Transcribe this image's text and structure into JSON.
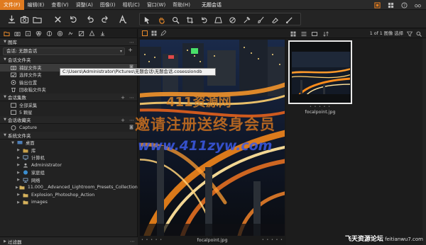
{
  "app": {
    "title": "无题会话"
  },
  "menu": [
    "文件(F)",
    "编辑(E)",
    "查看(V)",
    "调整(A)",
    "图像(I)",
    "相机(C)",
    "窗口(W)",
    "帮助(H)"
  ],
  "window_controls": [
    "restore-icon",
    "grid-icon",
    "help-icon",
    "glasses-icon"
  ],
  "toolbar": {
    "left_icons": [
      "import-icon",
      "camera-icon",
      "open-folder-icon",
      "delete-icon",
      "reset-icon",
      "undo-icon",
      "redo-icon",
      "text-icon"
    ],
    "tools": [
      "cursor-tool-icon",
      "hand-tool-icon",
      "zoom-tool-icon",
      "crop-tool-icon",
      "rotate-tool-icon",
      "keystone-tool-icon",
      "spot-tool-icon",
      "picker-tool-icon",
      "brush-tool-icon",
      "eraser-tool-icon",
      "gradient-tool-icon"
    ]
  },
  "left_panel": {
    "tabs": [
      "folder-icon",
      "camera-icon",
      "info-icon",
      "color-icon",
      "adjust-icon",
      "lens-icon",
      "details-icon",
      "exposure-icon",
      "sharpen-icon",
      "output-icon"
    ],
    "library_header": "图库",
    "session_label": "会话: 无题会话",
    "session_folders_header": "会话文件夹",
    "session_folders": [
      "捕捉文件夹",
      "选择文件夹",
      "输出位置",
      "回收箱文件夹"
    ],
    "session_albums_header": "会话集数",
    "session_albums": [
      "全部采集",
      "5 颗星"
    ],
    "favorites_header": "会话收藏夹",
    "favorites": [
      "Capture"
    ],
    "system_folders_header": "系统文件夹",
    "system_folders": [
      "桌面",
      "库",
      "计算机",
      "Administrator",
      "家庭组",
      "网络",
      "11.000__Advanced_Lightroom_Presets_Collection",
      "Explosion_Photoshop_Action",
      "images"
    ],
    "filters_label": "过滤器"
  },
  "tooltip": "C:\\Users\\Administrator\\Pictures\\无题会话\\无题会话.cosessiondb",
  "viewer": {
    "caption": "focalpoint.jpg",
    "dots_left": "• • • • •",
    "dots_right": "• • • • •"
  },
  "browser": {
    "count": "1 of 1 图像 选择",
    "thumb_name": "focalpoint.jpg",
    "thumb_dots": "• • • • •"
  },
  "watermarks": {
    "line1": "411资源网",
    "line2": "邀请注册送终身会员",
    "line3": "www.411zyw.com",
    "corner_cn": "飞天资源论坛",
    "corner_url": "feitianwu7.com"
  },
  "colors": {
    "accent": "#e07b20",
    "selection": "#3b3b3b",
    "panel": "#222222"
  }
}
